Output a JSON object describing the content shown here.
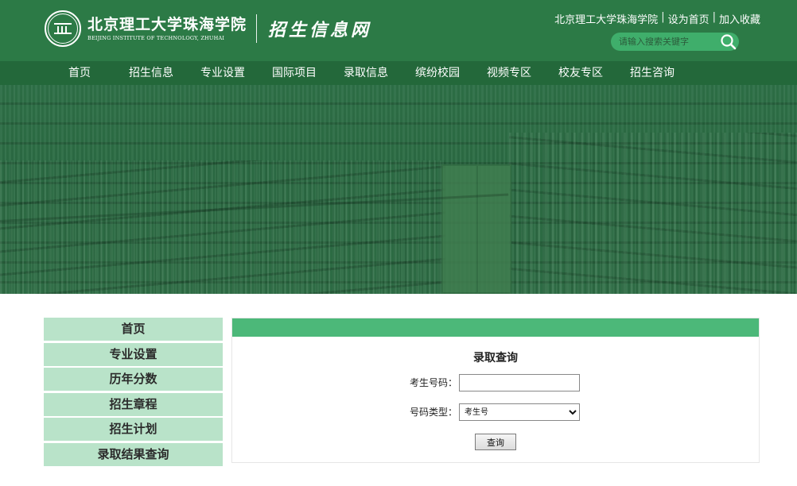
{
  "header": {
    "logo_cn": "北京理工大学珠海学院",
    "logo_en": "BEIJING INSTITUTE OF TECHNOLOGY, ZHUHAI",
    "site_name": "招生信息网",
    "top_links": [
      "北京理工大学珠海学院",
      "设为首页",
      "加入收藏"
    ],
    "search_placeholder": "请输入搜索关键字",
    "colors": {
      "header_bg": "#2c7a46",
      "nav_bg": "#23683a",
      "search_bg": "#3fae6b"
    }
  },
  "nav": {
    "items": [
      "首页",
      "招生信息",
      "专业设置",
      "国际项目",
      "录取信息",
      "缤纷校园",
      "视频专区",
      "校友专区",
      "招生咨询"
    ]
  },
  "sidebar": {
    "items": [
      "首页",
      "专业设置",
      "历年分数",
      "招生章程",
      "招生计划",
      "录取结果查询"
    ],
    "colors": {
      "item_bg": "#b9e3c9"
    }
  },
  "main": {
    "title": "录取查询",
    "form": {
      "id_label": "考生号码：",
      "id_value": "",
      "type_label": "号码类型：",
      "type_selected": "考生号",
      "submit_label": "查询"
    },
    "colors": {
      "panel_head": "#4cb879"
    }
  }
}
